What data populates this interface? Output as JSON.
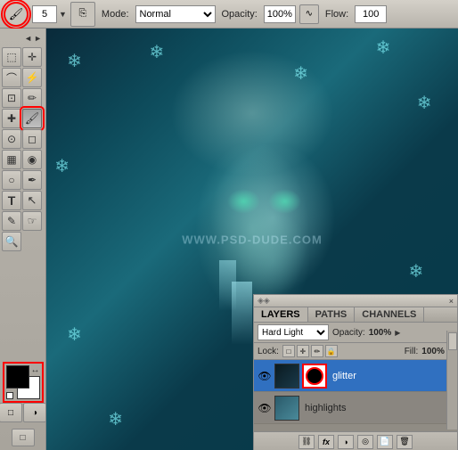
{
  "toolbar": {
    "brush_icon": "⬤",
    "brush_size": "5",
    "brush_options_icon": "▼",
    "clone_stamp_icon": "⎘",
    "mode_label": "Mode:",
    "mode_value": "Normal",
    "opacity_label": "Opacity:",
    "opacity_value": "100%",
    "airbrush_icon": "∿",
    "flow_label": "Flow:",
    "flow_value": "100"
  },
  "left_toolbar": {
    "tools": [
      {
        "id": "marquee",
        "icon": "⬚",
        "active": false
      },
      {
        "id": "move",
        "icon": "✛",
        "active": false
      },
      {
        "id": "lasso",
        "icon": "⌒",
        "active": false
      },
      {
        "id": "magic-wand",
        "icon": "⚡",
        "active": false
      },
      {
        "id": "crop",
        "icon": "⊡",
        "active": false
      },
      {
        "id": "eyedropper",
        "icon": "✏",
        "active": false
      },
      {
        "id": "healing",
        "icon": "✚",
        "active": false
      },
      {
        "id": "brush",
        "icon": "✏",
        "active": true
      },
      {
        "id": "clone",
        "icon": "⊙",
        "active": false
      },
      {
        "id": "eraser",
        "icon": "◻",
        "active": false
      },
      {
        "id": "gradient",
        "icon": "▦",
        "active": false
      },
      {
        "id": "blur",
        "icon": "◉",
        "active": false
      },
      {
        "id": "dodge",
        "icon": "○",
        "active": false
      },
      {
        "id": "pen",
        "icon": "✒",
        "active": false
      },
      {
        "id": "type",
        "icon": "T",
        "active": false
      },
      {
        "id": "path-select",
        "icon": "↖",
        "active": false
      },
      {
        "id": "shape",
        "icon": "▭",
        "active": false
      },
      {
        "id": "notes",
        "icon": "✎",
        "active": false
      },
      {
        "id": "hand",
        "icon": "☞",
        "active": false
      },
      {
        "id": "zoom",
        "icon": "🔍",
        "active": false
      }
    ],
    "fg_color": "black",
    "bg_color": "white"
  },
  "canvas": {
    "watermark": "WWW.PSD-DUDE.COM"
  },
  "layers_panel": {
    "header": "◈◈",
    "close": "×",
    "tabs": [
      {
        "id": "layers",
        "label": "LAYERS",
        "active": true
      },
      {
        "id": "paths",
        "label": "PATHS",
        "active": false
      },
      {
        "id": "channels",
        "label": "CHANNELS",
        "active": false
      }
    ],
    "blend_mode": "Hard Light",
    "opacity_label": "Opacity:",
    "opacity_value": "100%",
    "opacity_arrow": "▶",
    "lock_label": "Lock:",
    "lock_icons": [
      "□",
      "✛",
      "✏",
      "🔒"
    ],
    "fill_label": "Fill:",
    "fill_value": "100%",
    "layers": [
      {
        "id": "glitter",
        "name": "glitter",
        "visible": true,
        "selected": true,
        "thumb_bg": "#1a1a1a",
        "has_mask": true
      },
      {
        "id": "highlights",
        "name": "highlights",
        "visible": true,
        "selected": false,
        "thumb_bg": "#3a6a7a",
        "has_mask": false
      }
    ],
    "bottom_actions": [
      "⛓",
      "fx",
      "◑",
      "🗑",
      "📄",
      "📁"
    ]
  }
}
